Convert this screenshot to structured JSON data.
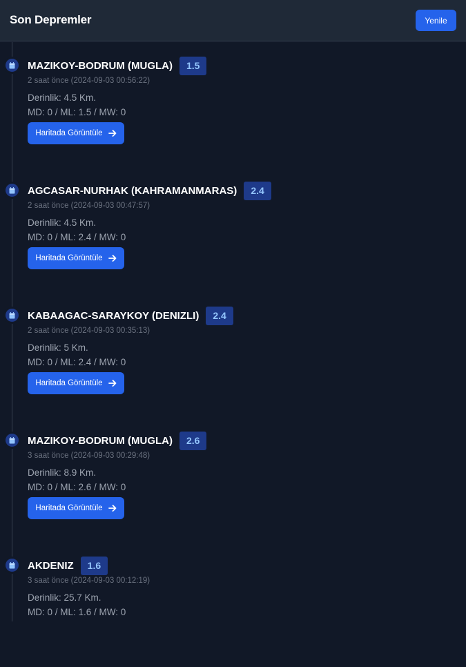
{
  "header": {
    "title": "Son Depremler",
    "refresh_label": "Yenile"
  },
  "colors": {
    "background": "#111827",
    "header_bg": "#1f2937",
    "accent": "#2563eb",
    "badge_bg": "#1e3a8a",
    "badge_text": "#93c5fd"
  },
  "icons": {
    "timeline_marker": "calendar-icon",
    "map_button_arrow": "arrow-right-icon"
  },
  "earthquakes": [
    {
      "location": "MAZIKOY-BODRUM (MUGLA)",
      "magnitude": "1.5",
      "time": "2 saat önce (2024-09-03 00:56:22)",
      "depth": "Derinlik: 4.5 Km.",
      "scales": "MD: 0 / ML: 1.5 / MW: 0",
      "button_label": "Haritada Görüntüle"
    },
    {
      "location": "AGCASAR-NURHAK (KAHRAMANMARAS)",
      "magnitude": "2.4",
      "time": "2 saat önce (2024-09-03 00:47:57)",
      "depth": "Derinlik: 4.5 Km.",
      "scales": "MD: 0 / ML: 2.4 / MW: 0",
      "button_label": "Haritada Görüntüle"
    },
    {
      "location": "KABAAGAC-SARAYKOY (DENIZLI)",
      "magnitude": "2.4",
      "time": "2 saat önce (2024-09-03 00:35:13)",
      "depth": "Derinlik: 5 Km.",
      "scales": "MD: 0 / ML: 2.4 / MW: 0",
      "button_label": "Haritada Görüntüle"
    },
    {
      "location": "MAZIKOY-BODRUM (MUGLA)",
      "magnitude": "2.6",
      "time": "3 saat önce (2024-09-03 00:29:48)",
      "depth": "Derinlik: 8.9 Km.",
      "scales": "MD: 0 / ML: 2.6 / MW: 0",
      "button_label": "Haritada Görüntüle"
    },
    {
      "location": "AKDENIZ",
      "magnitude": "1.6",
      "time": "3 saat önce (2024-09-03 00:12:19)",
      "depth": "Derinlik: 25.7 Km.",
      "scales": "MD: 0 / ML: 1.6 / MW: 0",
      "button_label": "Haritada Görüntüle"
    }
  ]
}
